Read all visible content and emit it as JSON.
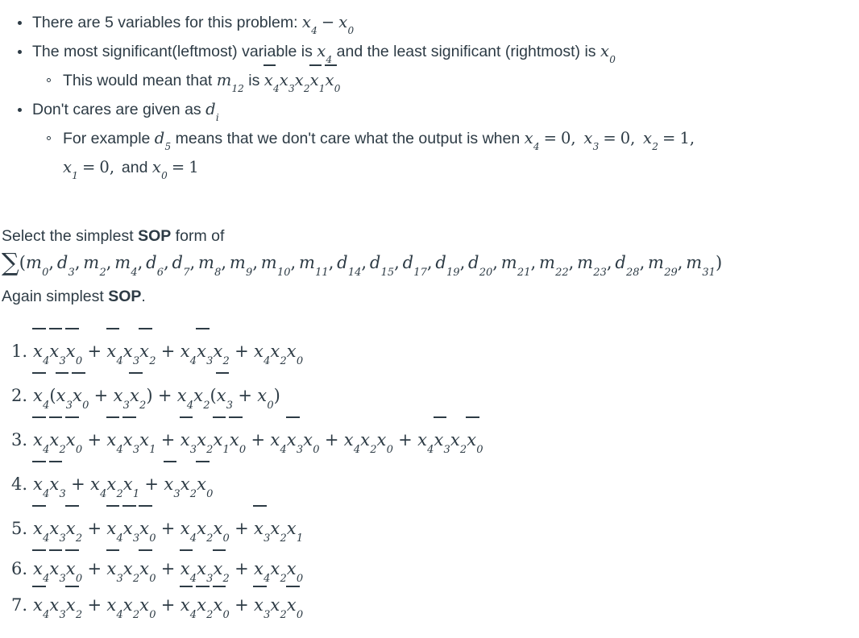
{
  "colors": {
    "text": "#2d3b45",
    "background": "#ffffff"
  },
  "intro": {
    "bullets": [
      {
        "level": 1,
        "text_before": "There are 5 variables for this problem: ",
        "math": "x_4 - x_0"
      },
      {
        "level": 1,
        "text_before": "The most significant(leftmost) variable is ",
        "math_1": "x_4",
        "text_mid": " and the least significant (rightmost) is ",
        "math_2": "x_0"
      },
      {
        "level": 2,
        "text_before": "This would mean that ",
        "math_1": "m_12",
        "text_mid": " is ",
        "math_2": "x̄_4 x_3 x_2 x̄_1 x̄_0"
      },
      {
        "level": 1,
        "text_before": "Don't cares are given as ",
        "math": "d_i"
      },
      {
        "level": 2,
        "text_before": "For example ",
        "math_1": "d_5",
        "text_mid": " means that we don't care what the output is when ",
        "math_2": "x_4 = 0, x_3 = 0, x_2 = 1,",
        "math_3": "x_1 = 0,",
        "text_end": " and ",
        "math_4": "x_0 = 1"
      }
    ]
  },
  "question": {
    "prompt_before": "Select the simplest ",
    "prompt_bold": "SOP",
    "prompt_after": " form of",
    "again_before": "Again simplest ",
    "again_bold": "SOP",
    "again_after": ".",
    "minterm_expression": {
      "symbol": "∑",
      "open_paren": "(",
      "close_paren": ")",
      "terms": [
        {
          "kind": "m",
          "index": "0"
        },
        {
          "kind": "d",
          "index": "3"
        },
        {
          "kind": "m",
          "index": "2"
        },
        {
          "kind": "m",
          "index": "4"
        },
        {
          "kind": "d",
          "index": "6"
        },
        {
          "kind": "d",
          "index": "7"
        },
        {
          "kind": "m",
          "index": "8"
        },
        {
          "kind": "m",
          "index": "9"
        },
        {
          "kind": "m",
          "index": "10"
        },
        {
          "kind": "m",
          "index": "11"
        },
        {
          "kind": "d",
          "index": "14"
        },
        {
          "kind": "d",
          "index": "15"
        },
        {
          "kind": "d",
          "index": "17"
        },
        {
          "kind": "d",
          "index": "19"
        },
        {
          "kind": "d",
          "index": "20"
        },
        {
          "kind": "m",
          "index": "21"
        },
        {
          "kind": "m",
          "index": "22"
        },
        {
          "kind": "m",
          "index": "23"
        },
        {
          "kind": "d",
          "index": "28"
        },
        {
          "kind": "m",
          "index": "29"
        },
        {
          "kind": "m",
          "index": "31"
        }
      ]
    }
  },
  "options": [
    {
      "number": "1.",
      "plain": "x̄4 x̄3 x̄0 + x̄4 x3 x̄2 + x4 x̄3 x2 + x4 x2 x0",
      "tokens": [
        {
          "t": "v",
          "n": "x",
          "s": "4",
          "bar": true
        },
        {
          "t": "v",
          "n": "x",
          "s": "3",
          "bar": true
        },
        {
          "t": "v",
          "n": "x",
          "s": "0",
          "bar": true
        },
        {
          "t": "op",
          "v": "+"
        },
        {
          "t": "v",
          "n": "x",
          "s": "4",
          "bar": true
        },
        {
          "t": "v",
          "n": "x",
          "s": "3",
          "bar": false
        },
        {
          "t": "v",
          "n": "x",
          "s": "2",
          "bar": true
        },
        {
          "t": "op",
          "v": "+"
        },
        {
          "t": "v",
          "n": "x",
          "s": "4",
          "bar": false
        },
        {
          "t": "v",
          "n": "x",
          "s": "3",
          "bar": true
        },
        {
          "t": "v",
          "n": "x",
          "s": "2",
          "bar": false
        },
        {
          "t": "op",
          "v": "+"
        },
        {
          "t": "v",
          "n": "x",
          "s": "4",
          "bar": false
        },
        {
          "t": "v",
          "n": "x",
          "s": "2",
          "bar": false
        },
        {
          "t": "v",
          "n": "x",
          "s": "0",
          "bar": false
        }
      ]
    },
    {
      "number": "2.",
      "plain": "x̄4 ( x̄3 x̄0 + x3 x̄2 ) + x4 x2 ( x̄3 + x0 )",
      "tokens": [
        {
          "t": "v",
          "n": "x",
          "s": "4",
          "bar": true
        },
        {
          "t": "paren",
          "v": "("
        },
        {
          "t": "v",
          "n": "x",
          "s": "3",
          "bar": true
        },
        {
          "t": "v",
          "n": "x",
          "s": "0",
          "bar": true
        },
        {
          "t": "op",
          "v": "+"
        },
        {
          "t": "v",
          "n": "x",
          "s": "3",
          "bar": false
        },
        {
          "t": "v",
          "n": "x",
          "s": "2",
          "bar": true
        },
        {
          "t": "paren",
          "v": ")"
        },
        {
          "t": "op",
          "v": "+"
        },
        {
          "t": "v",
          "n": "x",
          "s": "4",
          "bar": false
        },
        {
          "t": "v",
          "n": "x",
          "s": "2",
          "bar": false
        },
        {
          "t": "paren",
          "v": "("
        },
        {
          "t": "v",
          "n": "x",
          "s": "3",
          "bar": true
        },
        {
          "t": "op",
          "v": "+"
        },
        {
          "t": "v",
          "n": "x",
          "s": "0",
          "bar": false
        },
        {
          "t": "paren",
          "v": ")"
        }
      ]
    },
    {
      "number": "3.",
      "plain": "x̄4 x̄2 x̄0 + x̄4 x̄3 x1 + x̄3 x2 x̄1 x̄0 + x4 x̄3 x0 + x4 x2 x0 + x4 x̄3 x2 x̄0",
      "tokens": [
        {
          "t": "v",
          "n": "x",
          "s": "4",
          "bar": true
        },
        {
          "t": "v",
          "n": "x",
          "s": "2",
          "bar": true
        },
        {
          "t": "v",
          "n": "x",
          "s": "0",
          "bar": true
        },
        {
          "t": "op",
          "v": "+"
        },
        {
          "t": "v",
          "n": "x",
          "s": "4",
          "bar": true
        },
        {
          "t": "v",
          "n": "x",
          "s": "3",
          "bar": true
        },
        {
          "t": "v",
          "n": "x",
          "s": "1",
          "bar": false
        },
        {
          "t": "op",
          "v": "+"
        },
        {
          "t": "v",
          "n": "x",
          "s": "3",
          "bar": true
        },
        {
          "t": "v",
          "n": "x",
          "s": "2",
          "bar": false
        },
        {
          "t": "v",
          "n": "x",
          "s": "1",
          "bar": true
        },
        {
          "t": "v",
          "n": "x",
          "s": "0",
          "bar": true
        },
        {
          "t": "op",
          "v": "+"
        },
        {
          "t": "v",
          "n": "x",
          "s": "4",
          "bar": false
        },
        {
          "t": "v",
          "n": "x",
          "s": "3",
          "bar": true
        },
        {
          "t": "v",
          "n": "x",
          "s": "0",
          "bar": false
        },
        {
          "t": "op",
          "v": "+"
        },
        {
          "t": "v",
          "n": "x",
          "s": "4",
          "bar": false
        },
        {
          "t": "v",
          "n": "x",
          "s": "2",
          "bar": false
        },
        {
          "t": "v",
          "n": "x",
          "s": "0",
          "bar": false
        },
        {
          "t": "op",
          "v": "+"
        },
        {
          "t": "v",
          "n": "x",
          "s": "4",
          "bar": false
        },
        {
          "t": "v",
          "n": "x",
          "s": "3",
          "bar": true
        },
        {
          "t": "v",
          "n": "x",
          "s": "2",
          "bar": false
        },
        {
          "t": "v",
          "n": "x",
          "s": "0",
          "bar": true
        }
      ]
    },
    {
      "number": "4.",
      "plain": "x̄4 x̄3 + x4 x2 x1 + x̄3 x2 x̄0",
      "tokens": [
        {
          "t": "v",
          "n": "x",
          "s": "4",
          "bar": true
        },
        {
          "t": "v",
          "n": "x",
          "s": "3",
          "bar": true
        },
        {
          "t": "op",
          "v": "+"
        },
        {
          "t": "v",
          "n": "x",
          "s": "4",
          "bar": false
        },
        {
          "t": "v",
          "n": "x",
          "s": "2",
          "bar": false
        },
        {
          "t": "v",
          "n": "x",
          "s": "1",
          "bar": false
        },
        {
          "t": "op",
          "v": "+"
        },
        {
          "t": "v",
          "n": "x",
          "s": "3",
          "bar": true
        },
        {
          "t": "v",
          "n": "x",
          "s": "2",
          "bar": false
        },
        {
          "t": "v",
          "n": "x",
          "s": "0",
          "bar": true
        }
      ]
    },
    {
      "number": "5.",
      "plain": "x̄4 x3 x̄2 + x̄4 x̄3 x̄0 + x4 x2 x0 + x̄3 x2 x1",
      "tokens": [
        {
          "t": "v",
          "n": "x",
          "s": "4",
          "bar": true
        },
        {
          "t": "v",
          "n": "x",
          "s": "3",
          "bar": false
        },
        {
          "t": "v",
          "n": "x",
          "s": "2",
          "bar": true
        },
        {
          "t": "op",
          "v": "+"
        },
        {
          "t": "v",
          "n": "x",
          "s": "4",
          "bar": true
        },
        {
          "t": "v",
          "n": "x",
          "s": "3",
          "bar": true
        },
        {
          "t": "v",
          "n": "x",
          "s": "0",
          "bar": true
        },
        {
          "t": "op",
          "v": "+"
        },
        {
          "t": "v",
          "n": "x",
          "s": "4",
          "bar": false
        },
        {
          "t": "v",
          "n": "x",
          "s": "2",
          "bar": false
        },
        {
          "t": "v",
          "n": "x",
          "s": "0",
          "bar": false
        },
        {
          "t": "op",
          "v": "+"
        },
        {
          "t": "v",
          "n": "x",
          "s": "3",
          "bar": true
        },
        {
          "t": "v",
          "n": "x",
          "s": "2",
          "bar": false
        },
        {
          "t": "v",
          "n": "x",
          "s": "1",
          "bar": false
        }
      ]
    },
    {
      "number": "6.",
      "plain": "x̄4 x̄3 x̄0 + x̄3 x2 x̄0 + x̄4 x3 x̄2 + x4 x2 x0",
      "tokens": [
        {
          "t": "v",
          "n": "x",
          "s": "4",
          "bar": true
        },
        {
          "t": "v",
          "n": "x",
          "s": "3",
          "bar": true
        },
        {
          "t": "v",
          "n": "x",
          "s": "0",
          "bar": true
        },
        {
          "t": "op",
          "v": "+"
        },
        {
          "t": "v",
          "n": "x",
          "s": "3",
          "bar": true
        },
        {
          "t": "v",
          "n": "x",
          "s": "2",
          "bar": false
        },
        {
          "t": "v",
          "n": "x",
          "s": "0",
          "bar": true
        },
        {
          "t": "op",
          "v": "+"
        },
        {
          "t": "v",
          "n": "x",
          "s": "4",
          "bar": true
        },
        {
          "t": "v",
          "n": "x",
          "s": "3",
          "bar": false
        },
        {
          "t": "v",
          "n": "x",
          "s": "2",
          "bar": true
        },
        {
          "t": "op",
          "v": "+"
        },
        {
          "t": "v",
          "n": "x",
          "s": "4",
          "bar": false
        },
        {
          "t": "v",
          "n": "x",
          "s": "2",
          "bar": false
        },
        {
          "t": "v",
          "n": "x",
          "s": "0",
          "bar": false
        }
      ]
    },
    {
      "number": "7.",
      "plain": "x̄4 x3 x̄2 + x4 x2 x0 + x̄4 x̄2 x̄0 + x̄3 x2 x̄0",
      "tokens": [
        {
          "t": "v",
          "n": "x",
          "s": "4",
          "bar": true
        },
        {
          "t": "v",
          "n": "x",
          "s": "3",
          "bar": false
        },
        {
          "t": "v",
          "n": "x",
          "s": "2",
          "bar": true
        },
        {
          "t": "op",
          "v": "+"
        },
        {
          "t": "v",
          "n": "x",
          "s": "4",
          "bar": false
        },
        {
          "t": "v",
          "n": "x",
          "s": "2",
          "bar": false
        },
        {
          "t": "v",
          "n": "x",
          "s": "0",
          "bar": false
        },
        {
          "t": "op",
          "v": "+"
        },
        {
          "t": "v",
          "n": "x",
          "s": "4",
          "bar": true
        },
        {
          "t": "v",
          "n": "x",
          "s": "2",
          "bar": true
        },
        {
          "t": "v",
          "n": "x",
          "s": "0",
          "bar": true
        },
        {
          "t": "op",
          "v": "+"
        },
        {
          "t": "v",
          "n": "x",
          "s": "3",
          "bar": true
        },
        {
          "t": "v",
          "n": "x",
          "s": "2",
          "bar": false
        },
        {
          "t": "v",
          "n": "x",
          "s": "0",
          "bar": true
        }
      ]
    }
  ]
}
